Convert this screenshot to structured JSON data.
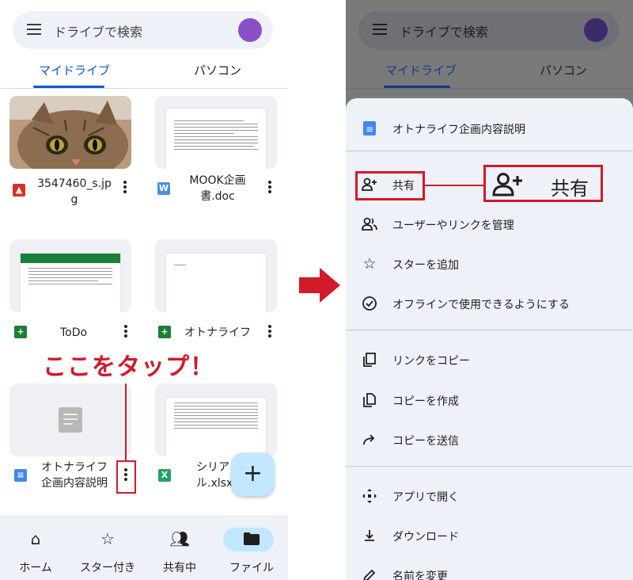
{
  "left": {
    "search": {
      "placeholder": "ドライブで検索"
    },
    "tabs": [
      {
        "label": "マイドライブ",
        "active": true
      },
      {
        "label": "パソコン",
        "active": false
      }
    ],
    "files": [
      {
        "name": "3547460_s.jp\ng",
        "type": "image",
        "icon": "image-icon",
        "color": "#d93025"
      },
      {
        "name": "MOOK企画\n書.doc",
        "type": "word",
        "icon": "word-icon",
        "color": "#4a8fe2"
      },
      {
        "name": "ToDo",
        "type": "sheets",
        "icon": "sheets-icon",
        "color": "#188038"
      },
      {
        "name": "オトナライフ",
        "type": "sheets",
        "icon": "sheets-icon",
        "color": "#188038"
      },
      {
        "name": "オトナライフ\n企画内容説明",
        "type": "docs",
        "icon": "docs-icon",
        "color": "#4285f4"
      },
      {
        "name": "シリア\nル.xlsx",
        "type": "excel",
        "icon": "excel-icon",
        "color": "#21a366"
      }
    ],
    "annotation": "ここをタップ！",
    "fab": {
      "label": "+"
    },
    "bottom_nav": [
      {
        "label": "ホーム",
        "icon": "home-icon"
      },
      {
        "label": "スター付き",
        "icon": "star-icon"
      },
      {
        "label": "共有中",
        "icon": "people-icon"
      },
      {
        "label": "ファイル",
        "icon": "folder-icon",
        "active": true
      }
    ]
  },
  "right": {
    "search": {
      "placeholder": "ドライブで検索"
    },
    "tabs": [
      {
        "label": "マイドライブ",
        "active": true
      },
      {
        "label": "パソコン",
        "active": false
      }
    ],
    "sheet": {
      "header": {
        "label": "オトナライフ企画内容説明",
        "icon": "docs-icon"
      },
      "items": [
        {
          "label": "共有",
          "icon": "person-add-icon"
        },
        {
          "label": "ユーザーやリンクを管理",
          "icon": "manage-people-icon"
        },
        {
          "label": "スターを追加",
          "icon": "star-outline-icon"
        },
        {
          "label": "オフラインで使用できるようにする",
          "icon": "offline-check-icon"
        },
        {
          "label": "リンクをコピー",
          "icon": "copy-link-icon"
        },
        {
          "label": "コピーを作成",
          "icon": "make-copy-icon"
        },
        {
          "label": "コピーを送信",
          "icon": "send-copy-icon"
        },
        {
          "label": "アプリで開く",
          "icon": "open-with-icon"
        },
        {
          "label": "ダウンロード",
          "icon": "download-icon"
        },
        {
          "label": "名前を変更",
          "icon": "rename-icon"
        }
      ]
    },
    "share_callout": {
      "label": "共有",
      "icon": "person-add-icon"
    }
  },
  "colors": {
    "accent": "#0b57d0",
    "annotation_red": "#d11a2a",
    "fab": "#c2e7ff",
    "sheet_bg": "#eef1f8"
  }
}
